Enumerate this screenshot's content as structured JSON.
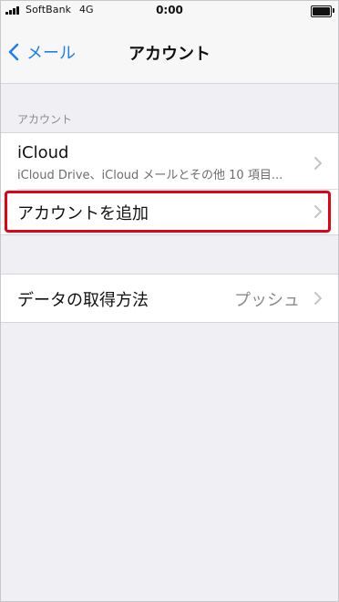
{
  "status_bar": {
    "carrier": "SoftBank",
    "network": "4G",
    "time": "0:00"
  },
  "nav": {
    "back_label": "メール",
    "title": "アカウント"
  },
  "accounts_section": {
    "header": "アカウント",
    "items": [
      {
        "title": "iCloud",
        "subtitle": "iCloud Drive、iCloud メールとその他 10 項目..."
      },
      {
        "title": "アカウントを追加"
      }
    ]
  },
  "fetch_section": {
    "items": [
      {
        "title": "データの取得方法",
        "value": "プッシュ"
      }
    ]
  },
  "colors": {
    "accent": "#1f7ff0",
    "highlight": "#e50012",
    "background": "#efeff4"
  },
  "icons": {
    "back": "chevron-left-icon",
    "disclosure": "chevron-right-icon",
    "signal": "signal-bars-icon",
    "battery": "battery-icon"
  }
}
